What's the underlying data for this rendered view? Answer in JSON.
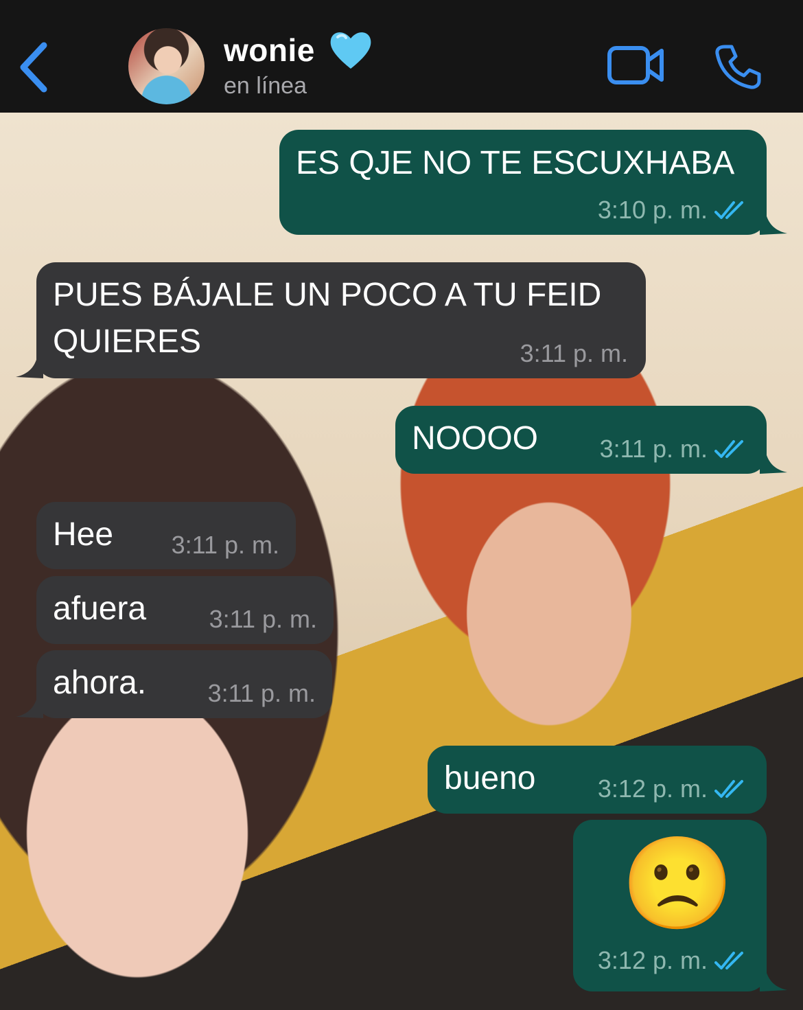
{
  "header": {
    "contact_name": "wonie",
    "status": "en línea"
  },
  "colors": {
    "header_bg": "#151515",
    "accent_blue": "#3a8ef0",
    "outgoing_bubble": "#105248",
    "incoming_bubble": "#363638",
    "read_ticks": "#34b7f1"
  },
  "icons": [
    "back-chevron-icon",
    "light-blue-heart-icon",
    "video-camera-icon",
    "phone-icon",
    "double-check-icon"
  ],
  "messages": [
    {
      "direction": "out",
      "text": "ES QJE NO TE ESCUXHABA",
      "time": "3:10 p. m.",
      "read": true
    },
    {
      "direction": "in",
      "line1": "PUES BÁJALE UN POCO A TU FEID",
      "line2": "QUIERES",
      "time": "3:11 p. m."
    },
    {
      "direction": "out",
      "text": "NOOOO",
      "time": "3:11 p. m.",
      "read": true
    },
    {
      "direction": "in",
      "text": "Hee",
      "time": "3:11 p. m."
    },
    {
      "direction": "in",
      "text": "afuera",
      "time": "3:11 p. m."
    },
    {
      "direction": "in",
      "text": "ahora.",
      "time": "3:11 p. m."
    },
    {
      "direction": "out",
      "text": "bueno",
      "time": "3:12 p. m.",
      "read": true
    },
    {
      "direction": "out",
      "emoji": "🙁",
      "time": "3:12 p. m.",
      "read": true
    }
  ]
}
